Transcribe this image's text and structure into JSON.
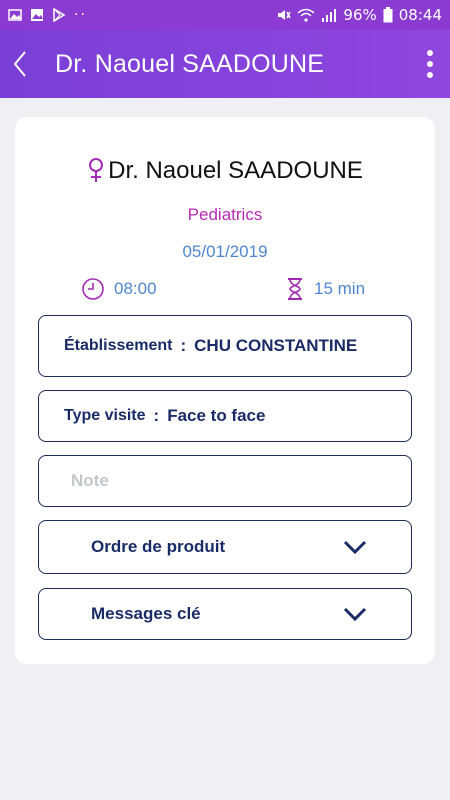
{
  "statusbar": {
    "battery": "96%",
    "time": "08:44",
    "left_icons": [
      "image-icon",
      "gallery-icon",
      "play-store-icon",
      "more-dots-icon"
    ],
    "right_icons": [
      "mute-icon",
      "wifi-icon",
      "signal-icon",
      "battery-icon"
    ]
  },
  "appbar": {
    "title": "Dr. Naouel SAADOUNE",
    "back_icon": "chevron-left-icon",
    "menu_icon": "more-vert-icon",
    "background": "#8b3bd1"
  },
  "card": {
    "gender_icon": "female-icon",
    "doctor_name": "Dr. Naouel SAADOUNE",
    "specialty": "Pediatrics",
    "date": "05/01/2019",
    "time": "08:00",
    "duration": "15 min",
    "fields": {
      "establishment": {
        "label": "Établissement",
        "sep": ":",
        "value": "CHU CONSTANTINE"
      },
      "visit_type": {
        "label": "Type visite",
        "sep": ":",
        "value": "Face to face"
      },
      "note": {
        "placeholder": "Note",
        "value": ""
      },
      "product_order": {
        "label": "Ordre de produit"
      },
      "key_messages": {
        "label": "Messages clé"
      }
    }
  },
  "colors": {
    "specialty": "#b62bb5",
    "accent_blue": "#4f86d1",
    "field_text": "#1a2c68",
    "border": "#1d2b55",
    "page_bg": "#efeff4"
  }
}
